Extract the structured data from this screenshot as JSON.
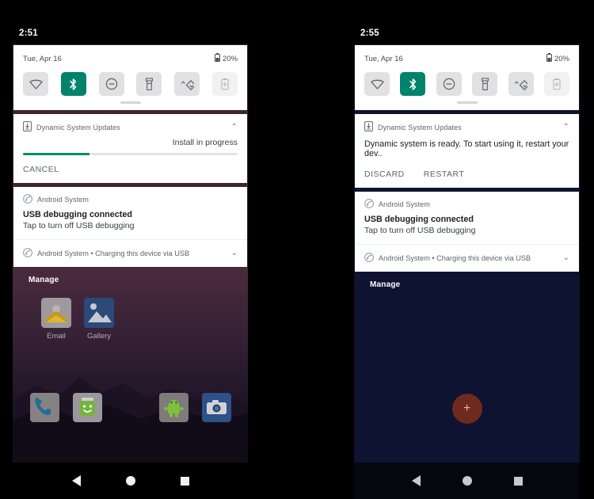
{
  "meta": {
    "accent_teal": "#00836b",
    "progress_teal": "#008b72",
    "left_wallpaper_top": "#4a2b3d",
    "right_background": "#0d1330",
    "fab_color": "#6e2a1e"
  },
  "left": {
    "status_time": "2:51",
    "quick_settings": {
      "date": "Tue, Apr 16",
      "battery_percent": "20%",
      "tiles": [
        {
          "name": "wifi-tile",
          "state": "off"
        },
        {
          "name": "bluetooth-tile",
          "state": "on"
        },
        {
          "name": "do-not-disturb-tile",
          "state": "off"
        },
        {
          "name": "flashlight-tile",
          "state": "off"
        },
        {
          "name": "auto-rotate-tile",
          "state": "off"
        },
        {
          "name": "battery-saver-tile",
          "state": "disabled"
        }
      ]
    },
    "notification_dsu": {
      "app_name": "Dynamic System Updates",
      "status_text": "Install in progress",
      "progress_percent": 31,
      "action_cancel": "CANCEL"
    },
    "notification_usb": {
      "app_name": "Android System",
      "title": "USB debugging connected",
      "subtitle": "Tap to turn off USB debugging"
    },
    "notification_charging": {
      "text": "Android System • Charging this device via USB"
    },
    "home": {
      "manage_label": "Manage",
      "apps": [
        {
          "label": "Email",
          "icon": "email-icon"
        },
        {
          "label": "Gallery",
          "icon": "gallery-icon"
        }
      ],
      "dock_icons": [
        "phone-icon",
        "messaging-icon",
        "android-icon",
        "camera-icon"
      ]
    },
    "navbar": {
      "back": "back-button",
      "home": "home-button",
      "recents": "recents-button"
    }
  },
  "right": {
    "status_time": "2:55",
    "quick_settings": {
      "date": "Tue, Apr 16",
      "battery_percent": "20%",
      "tiles": [
        {
          "name": "wifi-tile",
          "state": "off"
        },
        {
          "name": "bluetooth-tile",
          "state": "on"
        },
        {
          "name": "do-not-disturb-tile",
          "state": "off"
        },
        {
          "name": "flashlight-tile",
          "state": "off"
        },
        {
          "name": "auto-rotate-tile",
          "state": "off"
        },
        {
          "name": "battery-saver-tile",
          "state": "disabled"
        }
      ]
    },
    "notification_dsu": {
      "app_name": "Dynamic System Updates",
      "message": "Dynamic system is ready. To start using it, restart your dev..",
      "action_discard": "DISCARD",
      "action_restart": "RESTART"
    },
    "notification_usb": {
      "app_name": "Android System",
      "title": "USB debugging connected",
      "subtitle": "Tap to turn off USB debugging"
    },
    "notification_charging": {
      "text": "Android System • Charging this device via USB"
    },
    "home": {
      "manage_label": "Manage",
      "fab_label": "+"
    },
    "navbar": {
      "back": "back-button",
      "home": "home-button",
      "recents": "recents-button"
    }
  }
}
